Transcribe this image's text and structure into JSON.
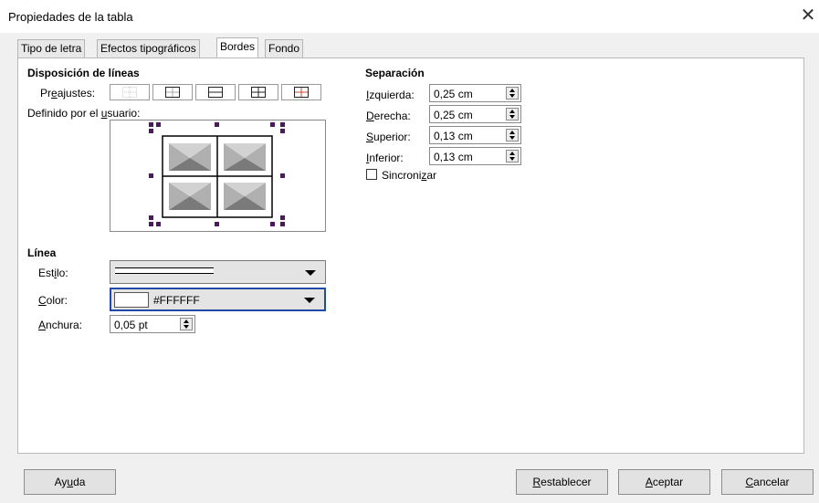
{
  "window": {
    "title": "Propiedades de la tabla",
    "close_glyph": "✕"
  },
  "tabs": [
    {
      "label": "Tipo de letra"
    },
    {
      "label": "Efectos tipográficos"
    },
    {
      "label": "Bordes"
    },
    {
      "label": "Fondo"
    }
  ],
  "lines": {
    "heading": "Disposición de líneas",
    "presets_label_pre": "Pr",
    "presets_label_key": "e",
    "presets_label_post": "ajustes:",
    "user_defined_pre": "Definido por el ",
    "user_defined_key": "u",
    "user_defined_post": "suario:"
  },
  "line": {
    "heading": "Línea",
    "style_label_pre": "Est",
    "style_label_key": "i",
    "style_label_post": "lo:",
    "color_label_key": "C",
    "color_label_post": "olor:",
    "color_value": "#FFFFFF",
    "color_swatch": "#ffffff",
    "width_label_key": "A",
    "width_label_post": "nchura:",
    "width_value": "0,05 pt"
  },
  "spacing": {
    "heading": "Separación",
    "left_key": "I",
    "left_post": "zquierda:",
    "left_value": "0,25 cm",
    "right_key": "D",
    "right_post": "erecha:",
    "right_value": "0,25 cm",
    "top_key": "S",
    "top_post": "uperior:",
    "top_value": "0,13 cm",
    "bottom_key": "I",
    "bottom_post": "nferior:",
    "bottom_value": "0,13 cm",
    "sync_pre": "Sincroni",
    "sync_key": "z",
    "sync_post": "ar"
  },
  "buttons": {
    "help_pre": "Ay",
    "help_key": "u",
    "help_post": "da",
    "reset_key": "R",
    "reset_post": "establecer",
    "ok_key": "A",
    "ok_post": "ceptar",
    "cancel_key": "C",
    "cancel_post": "ancelar"
  },
  "colors": {
    "marker": "#4b1a5c",
    "focus": "#1f4aa8"
  }
}
